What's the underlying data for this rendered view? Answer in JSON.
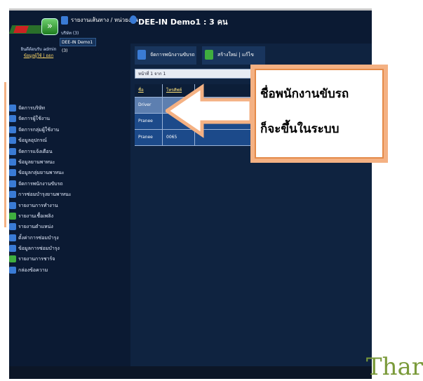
{
  "header": {
    "logo_arrow": "»",
    "user_info": "ยินดีต้อนรับ admin",
    "user_links": "ข้อมูลผู้ใช้ | ออก",
    "route_label": "รายงานเส้นทาง / หน่วยงาน",
    "company_title": "DEE-IN Demo1 : 3 คน",
    "company_select_label": "บริษัท (3)",
    "company_select_value": "DEE-IN Demo1 (3)"
  },
  "menu": {
    "items": [
      {
        "label": "จัดการบริษัท",
        "icon": "blue-icon",
        "color": "#3a7bd5"
      },
      {
        "label": "จัดการผู้ใช้งาน",
        "icon": "blue-icon",
        "color": "#3a7bd5"
      },
      {
        "label": "จัดการกลุ่มผู้ใช้งาน",
        "icon": "blue-icon",
        "color": "#3a7bd5"
      },
      {
        "label": "ข้อมูลอุปกรณ์",
        "icon": "blue-icon",
        "color": "#3a7bd5"
      },
      {
        "label": "จัดการแจ้งเตือน",
        "icon": "blue-icon",
        "color": "#3a7bd5"
      },
      {
        "label": "ข้อมูลยานพาหนะ",
        "icon": "blue-icon",
        "color": "#3a7bd5"
      },
      {
        "label": "ข้อมูลกลุ่มยานพาหนะ",
        "icon": "blue-icon",
        "color": "#3a7bd5"
      },
      {
        "label": "จัดการพนักงานขับรถ",
        "icon": "blue-icon",
        "color": "#3a7bd5"
      },
      {
        "label": "การซ่อมบำรุงยานพาหนะ",
        "icon": "blue-icon",
        "color": "#3a7bd5"
      },
      {
        "label": "รายงานการทำงาน",
        "icon": "blue-icon",
        "color": "#3a7bd5"
      },
      {
        "label": "รายงานเชื้อเพลิง",
        "icon": "green-icon",
        "color": "#3fae3f"
      },
      {
        "label": "รายงานตำแหน่ง",
        "icon": "blue-icon",
        "color": "#3a7bd5"
      },
      {
        "label": "ตั้งค่าการซ่อมบำรุง",
        "icon": "blue-icon",
        "color": "#3a7bd5"
      },
      {
        "label": "ข้อมูลการซ่อมบำรุง",
        "icon": "blue-icon",
        "color": "#3a7bd5"
      },
      {
        "label": "รายงานการชาร์จ",
        "icon": "green-icon",
        "color": "#3fae3f"
      },
      {
        "label": "กล่องข้อความ",
        "icon": "blue-icon",
        "color": "#3a7bd5"
      }
    ]
  },
  "main": {
    "tab_drivers": "จัดการพนักงานขับรถ",
    "tab_new": "สร้างใหม่ | แก้ไข",
    "toolbar_text": "หน้าที่ 1 จาก 1",
    "columns": [
      "ชื่อ",
      "โทรศัพท์",
      ""
    ],
    "rows": [
      [
        "Driver",
        "",
        ""
      ],
      [
        "Pranee",
        "",
        ""
      ],
      [
        "Pranee",
        "0065",
        ""
      ]
    ]
  },
  "callout": {
    "line1": "ชื่อพนักงานขับรถ",
    "line2": "ก็จะขึ้นในระบบ"
  },
  "watermark": "Thar",
  "colors": {
    "app_bg": "#0b1a33",
    "row_bg": "#1c4a8a",
    "selected_row_bg": "#5d7fb0",
    "callout_border": "#f4b183"
  }
}
